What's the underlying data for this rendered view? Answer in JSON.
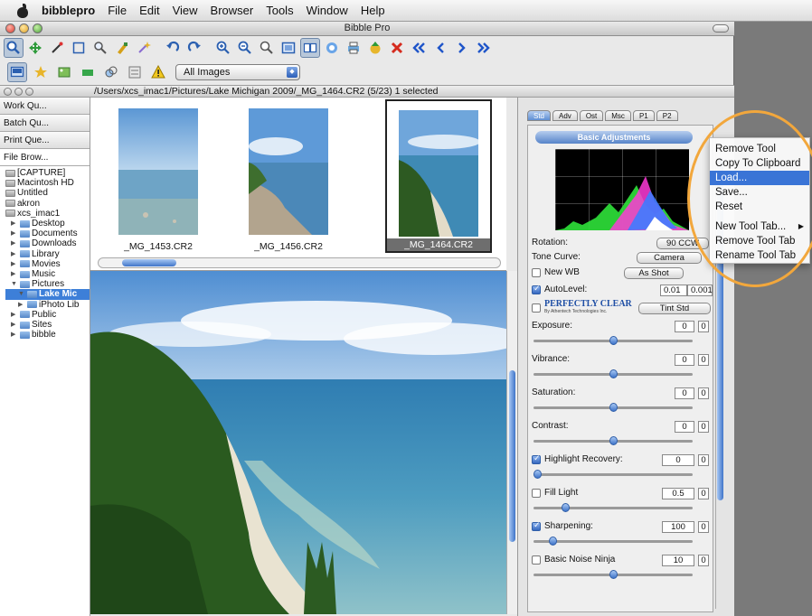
{
  "menubar": {
    "app_name": "bibblepro",
    "items": [
      "File",
      "Edit",
      "View",
      "Browser",
      "Tools",
      "Window",
      "Help"
    ]
  },
  "window": {
    "title": "Bibble Pro"
  },
  "toolbar2": {
    "filter_select": "All Images"
  },
  "pathbar": {
    "path": "/Users/xcs_imac1/Pictures/Lake Michigan 2009/_MG_1464.CR2 (5/23) 1 selected"
  },
  "left_tabs": [
    "Work Qu...",
    "Batch Qu...",
    "Print Que...",
    "File Brow..."
  ],
  "tree": [
    {
      "label": "[CAPTURE]",
      "kind": "drive",
      "tri": ""
    },
    {
      "label": "Macintosh HD",
      "kind": "drive",
      "tri": ""
    },
    {
      "label": "Untitled",
      "kind": "drive",
      "tri": ""
    },
    {
      "label": "akron",
      "kind": "drive",
      "tri": ""
    },
    {
      "label": "xcs_imac1",
      "kind": "home",
      "tri": "▼"
    },
    {
      "label": "Desktop",
      "kind": "folder",
      "tri": "▶"
    },
    {
      "label": "Documents",
      "kind": "folder",
      "tri": "▶"
    },
    {
      "label": "Downloads",
      "kind": "folder",
      "tri": "▶"
    },
    {
      "label": "Library",
      "kind": "folder",
      "tri": "▶"
    },
    {
      "label": "Movies",
      "kind": "folder",
      "tri": "▶"
    },
    {
      "label": "Music",
      "kind": "folder",
      "tri": "▶"
    },
    {
      "label": "Pictures",
      "kind": "folder",
      "tri": "▼"
    },
    {
      "label": "Lake Mic",
      "kind": "folder",
      "tri": "▼",
      "selected": true
    },
    {
      "label": "iPhoto Lib",
      "kind": "folder",
      "tri": "▶"
    },
    {
      "label": "Public",
      "kind": "folder",
      "tri": "▶"
    },
    {
      "label": "Sites",
      "kind": "folder",
      "tri": "▶"
    },
    {
      "label": "bibble",
      "kind": "folder",
      "tri": "▶"
    }
  ],
  "thumbnails": [
    {
      "caption": "_MG_1453.CR2"
    },
    {
      "caption": "_MG_1456.CR2"
    },
    {
      "caption": "_MG_1464.CR2"
    }
  ],
  "right_tabs": [
    "Std",
    "Adv",
    "Ost",
    "Msc",
    "P1",
    "P2"
  ],
  "basic_adjustments": "Basic Adjustments",
  "rotation": {
    "label": "Rotation:",
    "value": "90 CCW"
  },
  "tone_curve": {
    "label": "Tone Curve:",
    "value": "Camera"
  },
  "new_wb": {
    "label": "New WB",
    "value": "As Shot"
  },
  "autolevel": {
    "label": "AutoLevel:",
    "v1": "0.01",
    "v2": "0.001"
  },
  "perfectly_clear": {
    "label": "PERFECTLY CLEAR",
    "sub": "By Athentech Technologies Inc.",
    "value": "Tint Std"
  },
  "sliders": [
    {
      "label": "Exposure:",
      "value": "0",
      "pos": 0.5
    },
    {
      "label": "Vibrance:",
      "value": "0",
      "pos": 0.5
    },
    {
      "label": "Saturation:",
      "value": "0",
      "pos": 0.5
    },
    {
      "label": "Contrast:",
      "value": "0",
      "pos": 0.5
    }
  ],
  "check_sliders": [
    {
      "label": "Highlight Recovery:",
      "value": "0",
      "on": true,
      "pos": 0.02
    },
    {
      "label": "Fill Light",
      "value": "0.5",
      "on": false,
      "pos": 0.2
    },
    {
      "label": "Sharpening:",
      "value": "100",
      "on": true,
      "pos": 0.12
    },
    {
      "label": "Basic Noise Ninja",
      "value": "10",
      "on": false,
      "pos": 0.5
    }
  ],
  "context_menu": {
    "items": [
      "Remove Tool",
      "Copy To Clipboard",
      "Load...",
      "Save...",
      "Reset"
    ],
    "items2": [
      "New Tool Tab...",
      "Remove Tool Tab",
      "Rename Tool Tab"
    ],
    "highlighted": "Load..."
  }
}
